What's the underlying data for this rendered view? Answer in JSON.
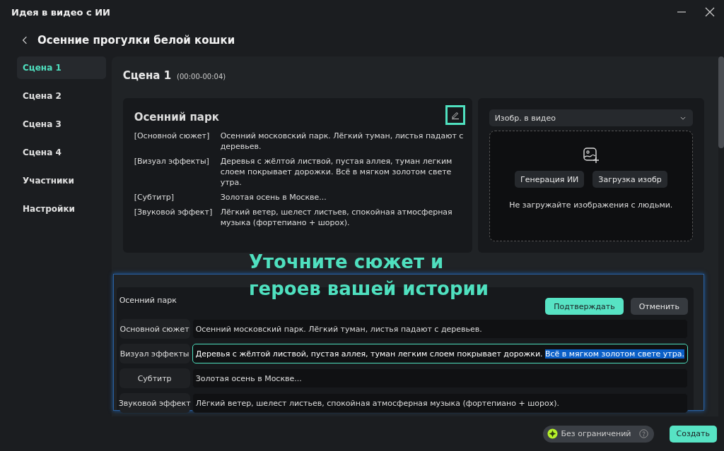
{
  "window": {
    "title": "Идея в видео с ИИ"
  },
  "header": {
    "title": "Осенние прогулки белой кошки"
  },
  "sidebar": {
    "items": [
      {
        "label": "Сцена 1",
        "selected": true
      },
      {
        "label": "Сцена 2",
        "selected": false
      },
      {
        "label": "Сцена 3",
        "selected": false
      },
      {
        "label": "Сцена 4",
        "selected": false
      },
      {
        "label": "Участники",
        "selected": false
      },
      {
        "label": "Настройки",
        "selected": false
      }
    ]
  },
  "scene": {
    "title": "Сцена 1",
    "time": "(00:00-00:04)",
    "card": {
      "title": "Осенний парк",
      "edit_highlighted": true,
      "rows": [
        {
          "label": "[Основной сюжет]",
          "value": "Осенний московский парк. Лёгкий туман, листья падают с деревьев."
        },
        {
          "label": "[Визуал эффекты]",
          "value": "Деревья с жёлтой листвой, пустая аллея, туман легким слоем покрывает дорожки. Всё в мягком золотом свете утра."
        },
        {
          "label": "[Субтитр]",
          "value": "Золотая осень в Москве..."
        },
        {
          "label": "[Звуковой эффект]",
          "value": "Лёгкий ветер, шелест листьев, спокойная атмосферная музыка (фортепиано + шорох)."
        }
      ]
    },
    "media": {
      "dropdown": "Изобр. в видео",
      "buttons": [
        "Генерация ИИ",
        "Загрузка изобр"
      ],
      "note": "Не загружайте изображения с людьми."
    }
  },
  "callout": "Уточните сюжет и героев вашей истории",
  "editor": {
    "title": "Осенний парк",
    "buttons": [
      {
        "label": "Подтверждать",
        "kind": "primary"
      },
      {
        "label": "Отменить",
        "kind": "secondary"
      }
    ],
    "fields": [
      {
        "label": "Основной сюжет",
        "value": "Осенний московский парк. Лёгкий туман, листья падают с деревьев.",
        "focused": false
      },
      {
        "label": "Визуал эффекты",
        "value": "Деревья с жёлтой листвой, пустая аллея, туман легким слоем покрывает дорожки.",
        "selected_text": "Всё в мягком золотом свете утра.",
        "focused": true
      },
      {
        "label": "Субтитр",
        "value": "Золотая осень в Москве...",
        "focused": false
      },
      {
        "label": "Звуковой эффект",
        "value": "Лёгкий ветер, шелест листьев, спокойная атмосферная музыка (фортепиано + шорох).",
        "focused": false
      }
    ]
  },
  "footer": {
    "plan": "Без ограничений",
    "button": "Создать"
  }
}
